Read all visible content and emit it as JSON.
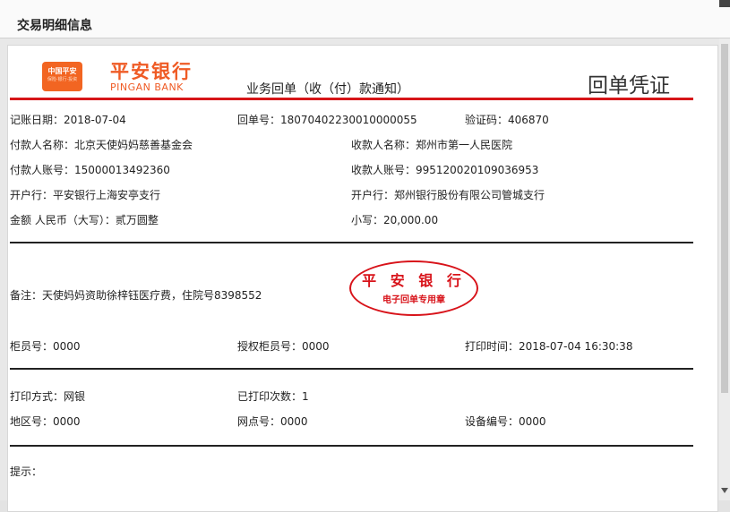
{
  "window": {
    "title": "交易明细信息"
  },
  "header": {
    "logo_cn": "中国平安",
    "logo_sub": "保险·银行·投资",
    "bank_cn": "平安银行",
    "bank_en": "PINGAN BANK",
    "notice": "业务回单（收（付）款通知）",
    "receipt": "回单凭证"
  },
  "fields": {
    "booking_date": "记账日期：2018-07-04",
    "receipt_no": "回单号：18070402230010000055",
    "verify_code": "验证码：406870",
    "payer_name": "付款人名称：北京天使妈妈慈善基金会",
    "payee_name": "收款人名称：郑州市第一人民医院",
    "payer_account": "付款人账号：15000013492360",
    "payee_account": "收款人账号：995120020109036953",
    "payer_bank": "开户行：平安银行上海安亭支行",
    "payee_bank": "开户行：郑州银行股份有限公司管城支行",
    "amount_upper": "金额 人民币（大写）：贰万圆整",
    "amount_lower": "小写：20,000.00",
    "remark": "备注：天使妈妈资助徐梓钰医疗费，住院号8398552",
    "teller_no": "柜员号：0000",
    "auth_teller_no": "授权柜员号：0000",
    "print_time": "打印时间：2018-07-04 16:30:38",
    "print_method": "打印方式：网银",
    "printed_count": "已打印次数：1",
    "region_no": "地区号：0000",
    "branch_no": "网点号：0000",
    "device_no": "设备编号：0000",
    "tips": "提示："
  },
  "stamp": {
    "top": "平 安 银 行",
    "bottom": "电子回单专用章"
  },
  "colors": {
    "brand": "#ef5b25",
    "rule_red": "#d61518",
    "stamp": "#d8131a"
  }
}
